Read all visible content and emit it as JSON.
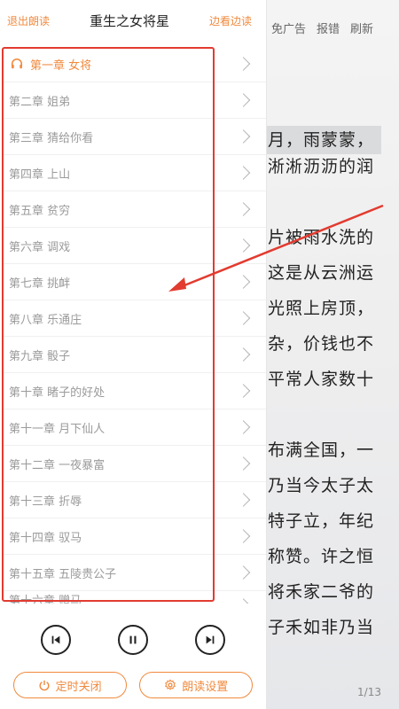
{
  "header": {
    "exit_label": "退出朗读",
    "title": "重生之女将星",
    "browse_label": "边看边读"
  },
  "chapters": [
    {
      "label": "第一章 女将"
    },
    {
      "label": "第二章 姐弟"
    },
    {
      "label": "第三章 猜给你看"
    },
    {
      "label": "第四章 上山"
    },
    {
      "label": "第五章 贫穷"
    },
    {
      "label": "第六章 调戏"
    },
    {
      "label": "第七章 挑衅"
    },
    {
      "label": "第八章 乐通庄"
    },
    {
      "label": "第九章 骰子"
    },
    {
      "label": "第十章 睹子的好处"
    },
    {
      "label": "第十一章 月下仙人"
    },
    {
      "label": "第十二章 一夜暴富"
    },
    {
      "label": "第十三章 折辱"
    },
    {
      "label": "第十四章 驭马"
    },
    {
      "label": "第十五章 五陵贵公子"
    },
    {
      "label": "第十六章 赠马"
    }
  ],
  "active_chapter_index": 0,
  "controls": {
    "timer_label": "定时关闭",
    "settings_label": "朗读设置"
  },
  "reader": {
    "top_items": [
      "免广告",
      "报错",
      "刷新"
    ],
    "lines": [
      "月，雨蒙蒙，",
      "淅淅沥沥的润",
      "",
      "片被雨水洗的",
      "这是从云洲运",
      "光照上房顶，",
      "杂，价钱也不",
      "平常人家数十",
      "",
      "布满全国，一",
      "乃当今太子太",
      "特子立，年纪",
      "称赞。许之恒",
      "将禾家二爷的",
      "子禾如非乃当"
    ],
    "page": "1/13"
  },
  "colors": {
    "accent": "#f08a3e",
    "annotation": "#e23b30"
  }
}
